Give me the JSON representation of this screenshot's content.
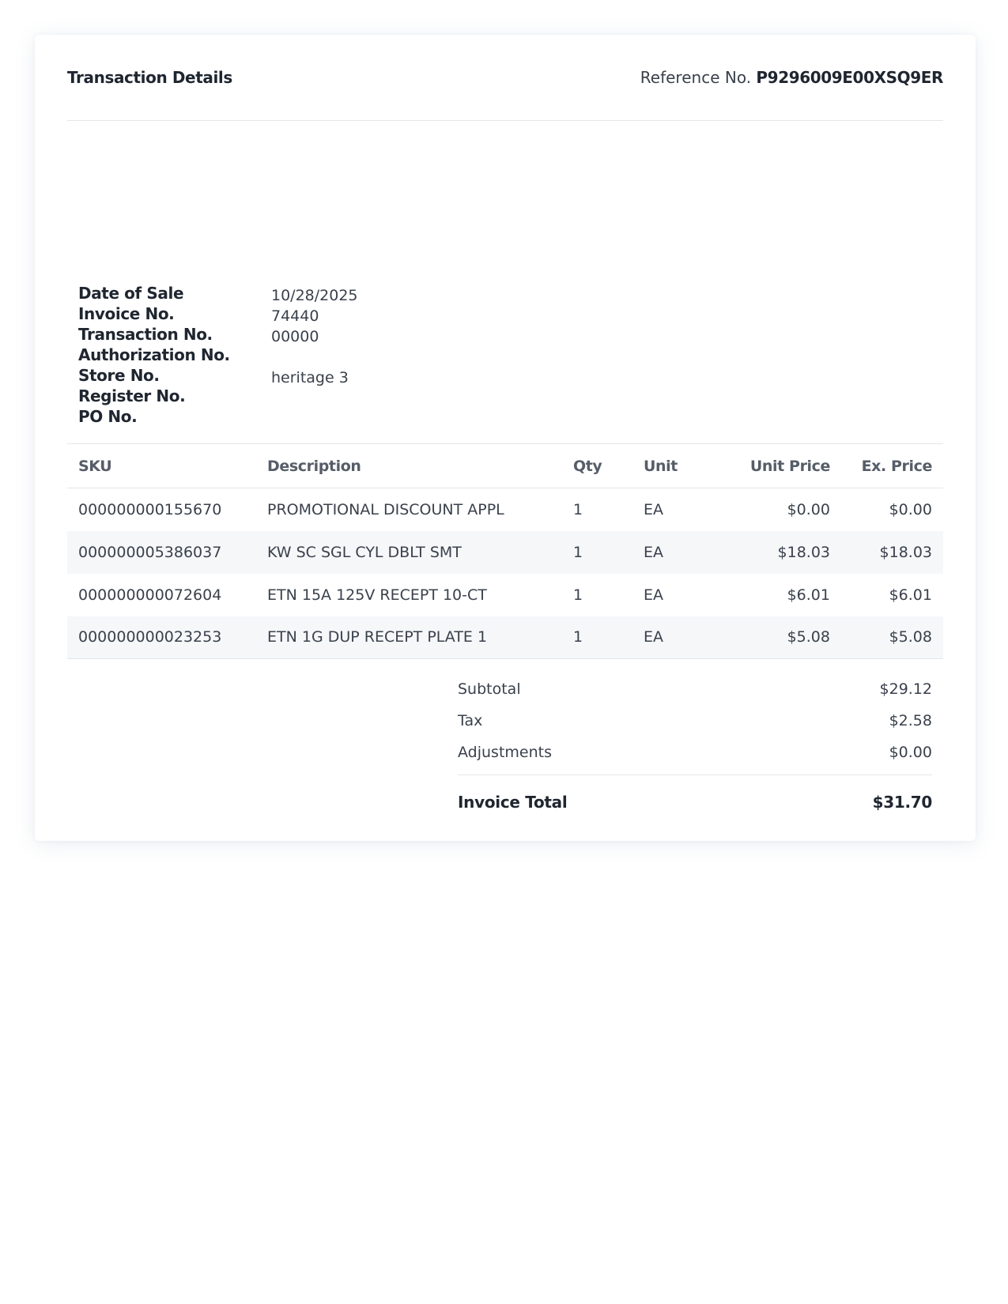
{
  "header": {
    "title": "Transaction Details",
    "reference_label": "Reference No.",
    "reference_value": "P9296009E00XSQ9ER"
  },
  "meta": [
    {
      "label": "Date of Sale",
      "value": "10/28/2025"
    },
    {
      "label": "Invoice No.",
      "value": "74440"
    },
    {
      "label": "Transaction No.",
      "value": "00000"
    },
    {
      "label": "Authorization No.",
      "value": ""
    },
    {
      "label": "Store No.",
      "value": "heritage 3"
    },
    {
      "label": "Register No.",
      "value": ""
    },
    {
      "label": "PO No.",
      "value": ""
    }
  ],
  "table": {
    "columns": [
      "SKU",
      "Description",
      "Qty",
      "Unit",
      "Unit Price",
      "Ex. Price"
    ],
    "rows": [
      [
        "000000000155670",
        "PROMOTIONAL DISCOUNT APPL",
        "1",
        "EA",
        "$0.00",
        "$0.00"
      ],
      [
        "000000005386037",
        "KW SC SGL CYL DBLT SMT",
        "1",
        "EA",
        "$18.03",
        "$18.03"
      ],
      [
        "000000000072604",
        "ETN 15A 125V RECEPT 10-CT",
        "1",
        "EA",
        "$6.01",
        "$6.01"
      ],
      [
        "000000000023253",
        "ETN 1G DUP RECEPT PLATE 1",
        "1",
        "EA",
        "$5.08",
        "$5.08"
      ]
    ]
  },
  "totals": {
    "subtotal_label": "Subtotal",
    "subtotal_value": "$29.12",
    "tax_label": "Tax",
    "tax_value": "$2.58",
    "adjustments_label": "Adjustments",
    "adjustments_value": "$0.00",
    "total_label": "Invoice Total",
    "total_value": "$31.70"
  }
}
